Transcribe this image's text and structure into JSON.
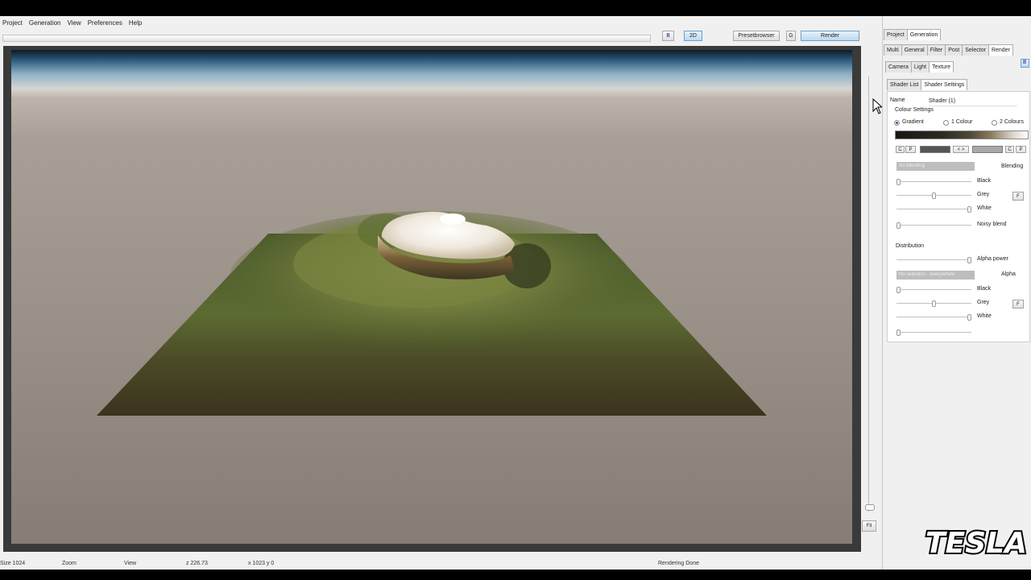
{
  "menu": [
    "Project",
    "Generation",
    "View",
    "Preferences",
    "Help"
  ],
  "toolbar": {
    "pause_label": "II",
    "twod_label": "2D",
    "presetbrowser_label": "Presetbrowser",
    "g_label": "G",
    "render_label": "Render",
    "fit_label": "Fit"
  },
  "tabs_level1": [
    "Project",
    "Generation"
  ],
  "tabs_level2": [
    "Multi",
    "General",
    "Filter",
    "Post",
    "Selector",
    "Render"
  ],
  "tabs_level3": [
    "Camera",
    "Light",
    "Texture"
  ],
  "tabs_level4": [
    "Shader List",
    "Shader Settings"
  ],
  "panel": {
    "pause_label": "II",
    "name_label": "Name",
    "name_value": "Shader (1)",
    "colour_settings": "Colour Settings",
    "radio_gradient": "Gradient",
    "radio_1colour": "1 Colour",
    "radio_2colours": "2 Colours",
    "btn_c": "C",
    "btn_p": "P",
    "btn_swap": "< >",
    "blending_combo": "No blending",
    "blending_label": "Blending",
    "black_label": "Black",
    "grey_label": "Grey",
    "white_label": "White",
    "f_label": "F",
    "noisy_blend_label": "Noisy blend",
    "distribution_label": "Distribution",
    "alpha_power_label": "Alpha power",
    "alpha_combo": "No selection - everywhere",
    "alpha_label": "Alpha",
    "black2_label": "Black",
    "grey2_label": "Grey",
    "white2_label": "White"
  },
  "sliders": {
    "black": 0.0,
    "grey": 0.5,
    "white": 1.0,
    "noisy_blend": 0.0,
    "alpha_power": 1.0,
    "black2": 0.0,
    "grey2": 0.5,
    "white2": 1.0,
    "extra": 0.0
  },
  "status": {
    "size": "Size 1024",
    "zoom": "Zoom",
    "view": "View",
    "z": "z 226.73",
    "xy": "x 1023 y 0",
    "rendering": "Rendering Done"
  },
  "watermark": "TESLA"
}
